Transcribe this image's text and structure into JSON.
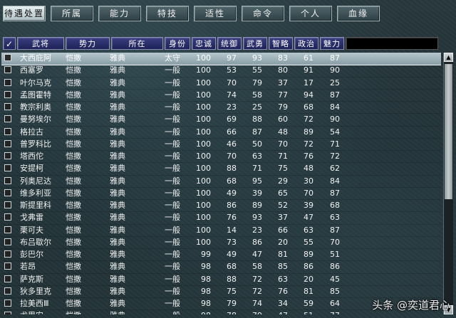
{
  "tabs": [
    {
      "label": "待遇处置",
      "active": true
    },
    {
      "label": "所属",
      "active": false
    },
    {
      "label": "能力",
      "active": false
    },
    {
      "label": "特技",
      "active": false
    },
    {
      "label": "适性",
      "active": false
    },
    {
      "label": "命令",
      "active": false
    },
    {
      "label": "个人",
      "active": false
    },
    {
      "label": "血缘",
      "active": false
    }
  ],
  "header": {
    "check": "✓",
    "columns": [
      "武将",
      "势力",
      "所在",
      "身份",
      "忠诚",
      "统御",
      "武勇",
      "智略",
      "政治",
      "魅力"
    ]
  },
  "rows": [
    [
      "大西庇阿",
      "恺撒",
      "雅典",
      "太守",
      "100",
      "97",
      "93",
      "83",
      "61",
      "87"
    ],
    [
      "西塞罗",
      "恺撒",
      "雅典",
      "一般",
      "100",
      "53",
      "55",
      "80",
      "91",
      "90"
    ],
    [
      "叶尔马克",
      "恺撒",
      "雅典",
      "一般",
      "100",
      "70",
      "79",
      "37",
      "17",
      "25"
    ],
    [
      "孟图霍特",
      "恺撒",
      "雅典",
      "一般",
      "100",
      "74",
      "58",
      "77",
      "94",
      "87"
    ],
    [
      "教宗利奥",
      "恺撒",
      "雅典",
      "一般",
      "100",
      "23",
      "25",
      "79",
      "68",
      "84"
    ],
    [
      "曼努埃尔",
      "恺撒",
      "雅典",
      "一般",
      "100",
      "69",
      "88",
      "60",
      "72",
      "90"
    ],
    [
      "格拉古",
      "恺撒",
      "雅典",
      "一般",
      "100",
      "66",
      "87",
      "48",
      "89",
      "54"
    ],
    [
      "普罗科比",
      "恺撒",
      "雅典",
      "一般",
      "100",
      "46",
      "50",
      "70",
      "72",
      "71"
    ],
    [
      "塔西佗",
      "恺撒",
      "雅典",
      "一般",
      "100",
      "70",
      "63",
      "71",
      "76",
      "72"
    ],
    [
      "安提柯",
      "恺撒",
      "雅典",
      "一般",
      "100",
      "88",
      "71",
      "75",
      "48",
      "62"
    ],
    [
      "列奥尼达",
      "恺撒",
      "雅典",
      "一般",
      "100",
      "68",
      "95",
      "29",
      "30",
      "84"
    ],
    [
      "维多利亚",
      "恺撒",
      "雅典",
      "一般",
      "100",
      "49",
      "39",
      "65",
      "70",
      "87"
    ],
    [
      "斯提里科",
      "恺撒",
      "雅典",
      "一般",
      "100",
      "86",
      "89",
      "52",
      "39",
      "68"
    ],
    [
      "戈弗雷",
      "恺撒",
      "雅典",
      "一般",
      "100",
      "76",
      "93",
      "37",
      "47",
      "63"
    ],
    [
      "栗可夫",
      "恺撒",
      "雅典",
      "一般",
      "100",
      "14",
      "23",
      "66",
      "63",
      "87"
    ],
    [
      "布吕歇尔",
      "恺撒",
      "雅典",
      "一般",
      "100",
      "73",
      "86",
      "20",
      "55",
      "70"
    ],
    [
      "彭巴尔",
      "恺撒",
      "雅典",
      "一般",
      "99",
      "49",
      "47",
      "81",
      "89",
      "51"
    ],
    [
      "若昂",
      "恺撒",
      "雅典",
      "一般",
      "98",
      "68",
      "58",
      "85",
      "86",
      "86"
    ],
    [
      "萨克斯",
      "恺撒",
      "雅典",
      "一般",
      "98",
      "88",
      "72",
      "63",
      "20",
      "45"
    ],
    [
      "狄多里克",
      "恺撒",
      "雅典",
      "一般",
      "98",
      "75",
      "72",
      "76",
      "81",
      "85"
    ],
    [
      "拉美西Ⅲ",
      "恺撒",
      "雅典",
      "一般",
      "98",
      "79",
      "74",
      "34",
      "59",
      "64"
    ],
    [
      "尤里安",
      "恺撒",
      "雅典",
      "一般",
      "98",
      "78",
      "79",
      "47",
      "51",
      "77"
    ]
  ],
  "selected_row": 0,
  "scrollbar": {
    "up": "▲",
    "down": "▼"
  },
  "watermark": "头条 @奕道君心"
}
